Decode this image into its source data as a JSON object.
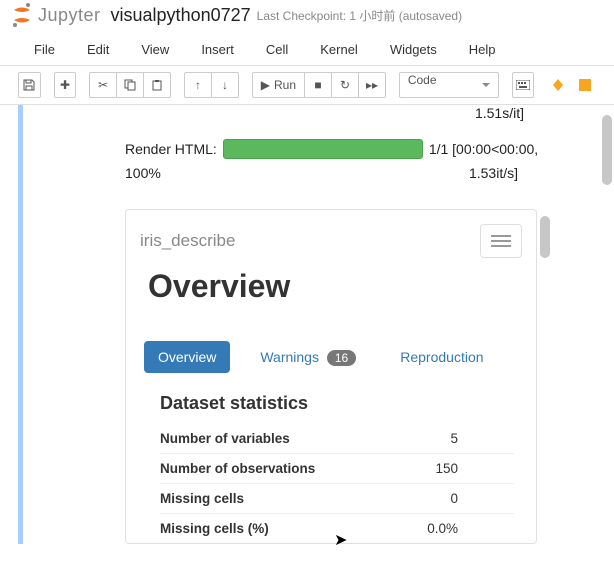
{
  "header": {
    "logo_text": "Jupyter",
    "notebook_name": "visualpython0727",
    "checkpoint": "Last Checkpoint: 1 小时前   (autosaved)"
  },
  "menu": {
    "file": "File",
    "edit": "Edit",
    "view": "View",
    "insert": "Insert",
    "cell": "Cell",
    "kernel": "Kernel",
    "widgets": "Widgets",
    "help": "Help"
  },
  "toolbar": {
    "run_label": "Run",
    "cell_type": "Code"
  },
  "output": {
    "top_small": "1.51s/it]",
    "render_label": "Render HTML:",
    "stats_right": "1/1 [00:00<00:00,",
    "percent": "100%",
    "rate": "1.53it/s]"
  },
  "report": {
    "name": "iris_describe",
    "title": "Overview",
    "tabs": {
      "overview": "Overview",
      "warnings": "Warnings",
      "warnings_count": "16",
      "reproduction": "Reproduction"
    },
    "section_title": "Dataset statistics",
    "stats": [
      {
        "label": "Number of variables",
        "value": "5"
      },
      {
        "label": "Number of observations",
        "value": "150"
      },
      {
        "label": "Missing cells",
        "value": "0"
      },
      {
        "label": "Missing cells (%)",
        "value": "0.0%"
      }
    ]
  }
}
